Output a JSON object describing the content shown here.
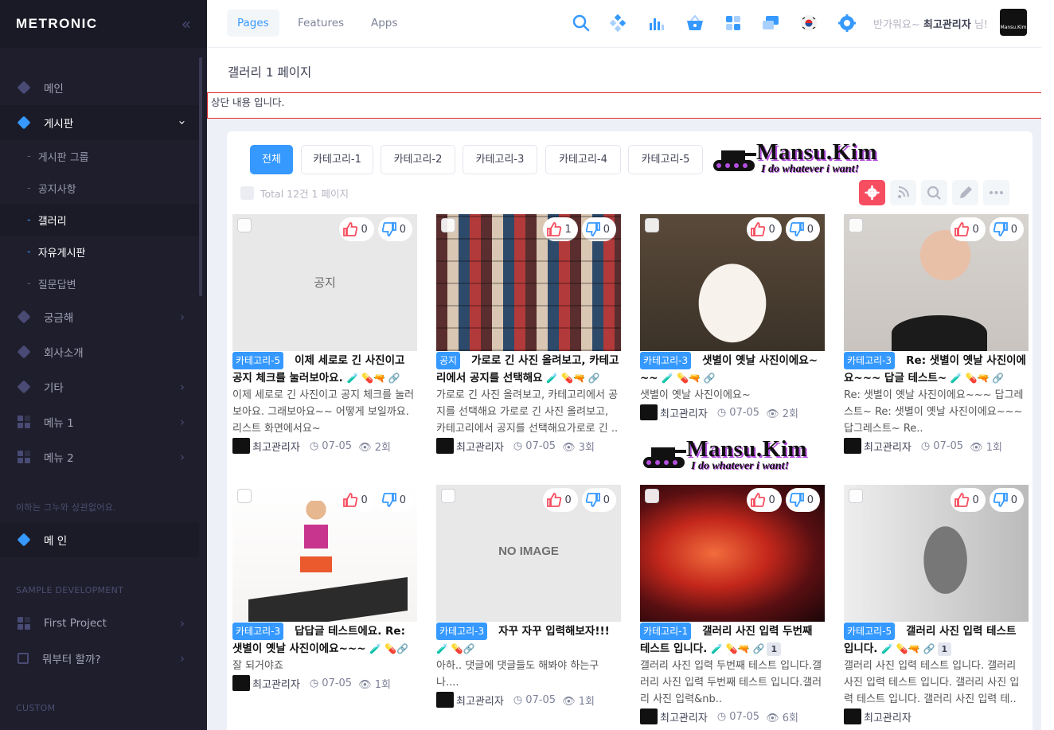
{
  "sidebar": {
    "brand": "METRONIC",
    "toggle_icon": "«",
    "items": [
      {
        "label": "메인",
        "icon": "diamond-icon"
      },
      {
        "label": "게시판",
        "icon": "diamond-icon",
        "arrow": "›"
      },
      {
        "label": "궁금해",
        "icon": "diamond-icon",
        "arrow": "›"
      },
      {
        "label": "회사소개",
        "icon": "diamond-icon"
      },
      {
        "label": "기타",
        "icon": "diamond-icon",
        "arrow": "›"
      },
      {
        "label": "메뉴 1",
        "icon": "grid-icon",
        "arrow": "›"
      },
      {
        "label": "메뉴 2",
        "icon": "grid-icon",
        "arrow": "›"
      },
      {
        "label": "메 인",
        "icon": "diamond-icon"
      },
      {
        "label": "First Project",
        "icon": "grid-icon",
        "arrow": "›"
      },
      {
        "label": "뭐부터 할까?",
        "icon": "bracket-icon",
        "arrow": "›"
      }
    ],
    "subitems": [
      {
        "label": "게시판 그룹"
      },
      {
        "label": "공지사항"
      },
      {
        "label": "갤러리"
      },
      {
        "label": "자유게시판"
      },
      {
        "label": "질문답변"
      }
    ],
    "sections": {
      "note": "이하는 그누와 상관없어요.",
      "sample": "SAMPLE DEVELOPMENT",
      "custom": "CUSTOM"
    }
  },
  "header": {
    "tabs": [
      "Pages",
      "Features",
      "Apps"
    ],
    "welcome_prefix": "반가워요~",
    "user_name": "최고관리자",
    "welcome_suffix": "님!",
    "avatar_text": "Mansu.Kim"
  },
  "page": {
    "title": "갤러리 1 페이지",
    "top_note": "상단 내용 입니다."
  },
  "board": {
    "categories": [
      "전체",
      "카테고리-1",
      "카테고리-2",
      "카테고리-3",
      "카테고리-4",
      "카테고리-5"
    ],
    "banner_title": "Mansu.Kim",
    "banner_sub": "I do whatever i want!",
    "total": "Total 12건 1 페이지",
    "posts": [
      {
        "badge": "카테고리-5",
        "title": "이제 세로로 긴 사진이고 공지 체크를 눌러보아요.",
        "emoji": "🧪 💊🔫 🔗",
        "count": "",
        "desc": "이제 세로로 긴 사진이고 공지 체크를 눌러보아요. 그래보아요~~   어떻게 보일까요. 리스트 화면에서요~",
        "author": "최고관리자",
        "date": "07-05",
        "views": "2회",
        "likes": "0",
        "dislikes": "0",
        "thumb_text": "공지",
        "thumb": "blank"
      },
      {
        "badge": "공지",
        "title": "가로로 긴 사진 올려보고, 카테고리에서 공지를 선택해요",
        "emoji": "🧪 💊🔫 🔗",
        "count": "",
        "desc": "가로로 긴 사진 올려보고, 카테고리에서 공지를 선택해요 가로로 긴 사진 올려보고, 카테고리에서 공지를 선택해요가로로 긴 ..",
        "author": "최고관리자",
        "date": "07-05",
        "views": "3회",
        "likes": "1",
        "dislikes": "0",
        "thumb_text": "",
        "thumb": "collage"
      },
      {
        "badge": "카테고리-3",
        "title": "샛별이 옛날 사진이에요~~~",
        "emoji": "🧪 💊🔫 🔗",
        "count": "",
        "desc": "샛별이 옛날 사진이에요~",
        "author": "최고관리자",
        "date": "07-05",
        "views": "2회",
        "likes": "0",
        "dislikes": "0",
        "thumb_text": "",
        "thumb": "dress"
      },
      {
        "badge": "카테고리-3",
        "title": "Re: 샛별이 옛날 사진이에요~~~ 답글 테스트~",
        "emoji": "🧪 💊🔫 🔗",
        "count": "",
        "desc": "Re: 샛별이 옛날 사진이에요~~~ 답그레스트~  Re: 샛별이 옛날 사진이에요~~~ 답그레스트~ Re..",
        "author": "최고관리자",
        "date": "07-05",
        "views": "1회",
        "likes": "0",
        "dislikes": "0",
        "thumb_text": "",
        "thumb": "woman"
      },
      {
        "badge": "카테고리-3",
        "title": "답답글 테스트에요. Re: 샛별이 옛날 사진이에요~~~",
        "emoji": "🧪 💊🔗",
        "count": "",
        "desc": "잘 되거야죠",
        "author": "최고관리자",
        "date": "07-05",
        "views": "1회",
        "likes": "0",
        "dislikes": "0",
        "thumb_text": "",
        "thumb": "run"
      },
      {
        "badge": "카테고리-3",
        "title": "자꾸 자꾸 입력해보자!!!",
        "emoji": "🧪 💊🔗",
        "count": "",
        "desc": "아하.. 댓글에 댓글들도 해봐야 하는구나....",
        "author": "최고관리자",
        "date": "07-05",
        "views": "1회",
        "likes": "0",
        "dislikes": "0",
        "thumb_text": "NO IMAGE",
        "thumb": "noimage"
      },
      {
        "badge": "카테고리-1",
        "title": "갤러리 사진 입력 두번째 테스트 입니다.",
        "emoji": "🧪 💊🔫 🔗",
        "count": "1",
        "desc": "갤러리 사진 입력 두번째 테스트 입니다.갤러리 사진 입력 두번째 테스트 입니다.갤러리 사진 입력&nb..",
        "author": "최고관리자",
        "date": "07-05",
        "views": "6회",
        "likes": "0",
        "dislikes": "0",
        "thumb_text": "",
        "thumb": "nebula"
      },
      {
        "badge": "카테고리-5",
        "title": "갤러리 사진 입력 테스트 입니다.",
        "emoji": "🧪 💊🔫 🔗",
        "count": "1",
        "desc": "갤러리 사진 입력 테스트 입니다. 갤러리 사진 입력 테스트 입니다. 갤러리 사진 입력 테스트 입니다. 갤러리 사진 입력 테..",
        "author": "최고관리자",
        "date": "",
        "views": "",
        "likes": "0",
        "dislikes": "0",
        "thumb_text": "",
        "thumb": "man"
      }
    ]
  },
  "colors": {
    "accent": "#3699ff",
    "danger": "#f64e60",
    "sidebar_bg": "#1e1e2d"
  }
}
